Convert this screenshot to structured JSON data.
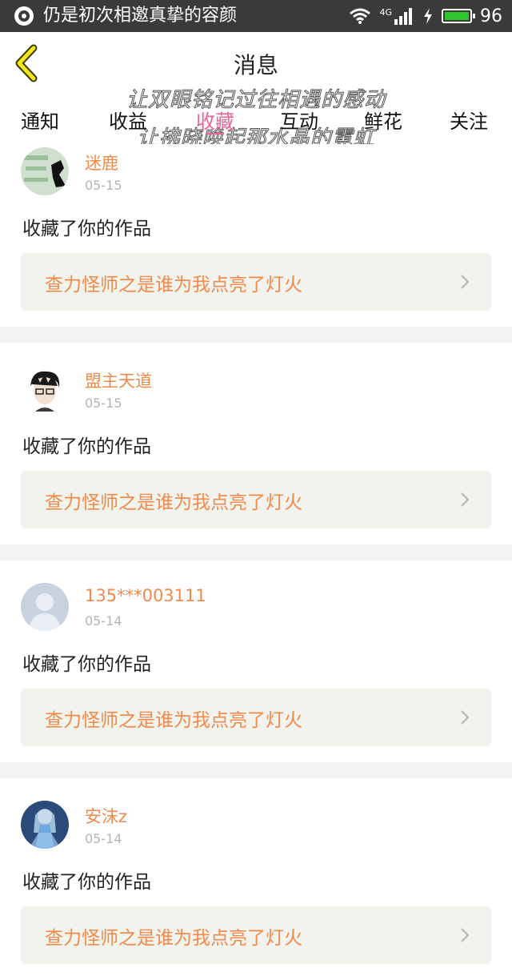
{
  "status_bar": {
    "app_icon": "app-logo-icon",
    "notification_text": "仍是初次相邀真挚的容颜",
    "network_label": "4G",
    "battery_percent": "96",
    "icons": [
      "wifi-icon",
      "signal-icon",
      "charging-icon",
      "battery-icon"
    ]
  },
  "header": {
    "back_icon": "chevron-left-icon",
    "title": "消息",
    "overlay_line_1": "让双眼铭记过往相遇的感动",
    "overlay_line_2": "让拂晓唤起那水晶的霓虹"
  },
  "tabs": [
    {
      "label": "通知"
    },
    {
      "label": "收益"
    },
    {
      "label": "收藏",
      "active": true
    },
    {
      "label": "互动"
    },
    {
      "label": "鲜花"
    },
    {
      "label": "关注"
    }
  ],
  "colors": {
    "accent_pink": "#e8659a",
    "username_orange": "#f08a4b",
    "card_bg": "#f3f3ee",
    "status_bar_bg": "#3a3a3a"
  },
  "messages": [
    {
      "username": "迷鹿",
      "date": "05-15",
      "action": "收藏了你的作品",
      "work_title": "查力怪师之是谁为我点亮了灯火"
    },
    {
      "username": "盟主天道",
      "date": "05-15",
      "action": "收藏了你的作品",
      "work_title": "查力怪师之是谁为我点亮了灯火"
    },
    {
      "username": "135***003111",
      "date": "05-14",
      "action": "收藏了你的作品",
      "work_title": "查力怪师之是谁为我点亮了灯火"
    },
    {
      "username": "安沫z",
      "date": "05-14",
      "action": "收藏了你的作品",
      "work_title": "查力怪师之是谁为我点亮了灯火"
    }
  ]
}
